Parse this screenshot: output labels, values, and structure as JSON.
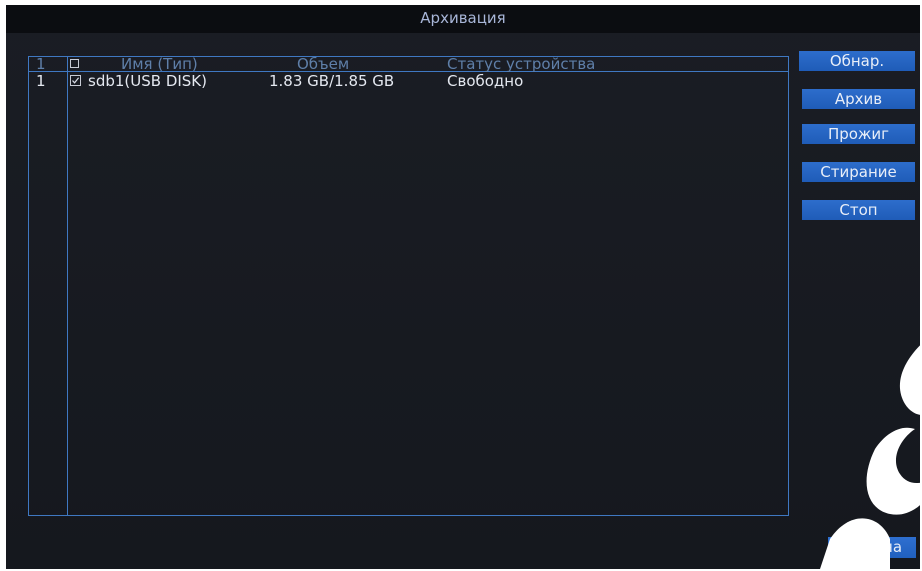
{
  "window": {
    "title": "Архивация"
  },
  "table": {
    "header": {
      "index": "1",
      "name": "Имя (Тип)",
      "volume": "Объем",
      "status": "Статус устройства"
    },
    "rows": [
      {
        "index": "1",
        "checked": true,
        "name": "sdb1(USB DISK)",
        "volume": "1.83 GB/1.85 GB",
        "status": "Свободно"
      }
    ]
  },
  "buttons": {
    "scan": "Обнар.",
    "backup": "Архив",
    "burn": "Прожиг",
    "erase": "Стирание",
    "stop": "Стоп",
    "cancel": "Отмена"
  },
  "colors": {
    "accent": "#2d6dcc",
    "border": "#3f78c2",
    "background": "#1a1d24",
    "header_text": "#5f7fa9"
  }
}
